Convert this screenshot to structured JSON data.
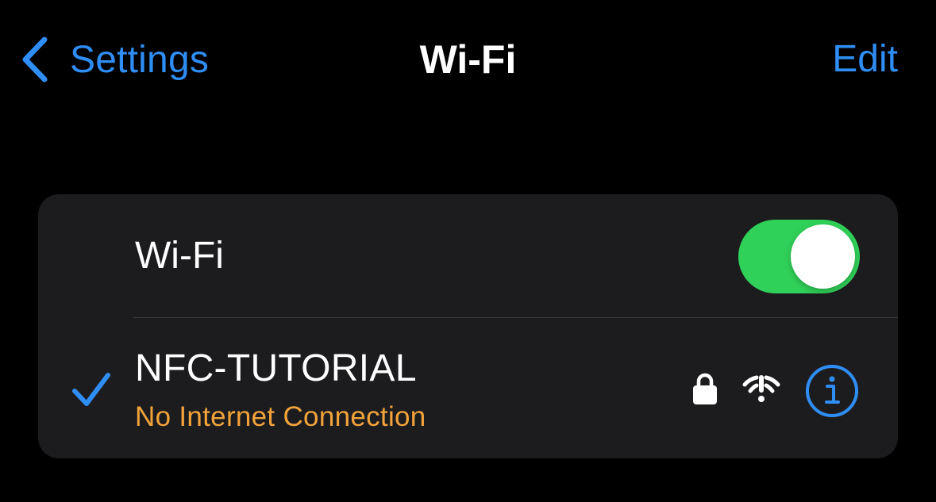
{
  "nav": {
    "back_label": "Settings",
    "title": "Wi-Fi",
    "edit_label": "Edit"
  },
  "wifi_toggle": {
    "label": "Wi-Fi",
    "on": true
  },
  "network": {
    "name": "NFC-TUTORIAL",
    "status": "No Internet Connection",
    "connected": true,
    "secured": true
  },
  "icons": {
    "back": "chevron-left-icon",
    "check": "checkmark-icon",
    "lock": "lock-icon",
    "wifi": "wifi-exclamation-icon",
    "info": "info-circle-icon"
  },
  "colors": {
    "accent": "#2f8ef5",
    "toggle_on": "#30d158",
    "warning": "#f2a33a",
    "cell_background": "#1c1c1e",
    "background": "#000000"
  }
}
